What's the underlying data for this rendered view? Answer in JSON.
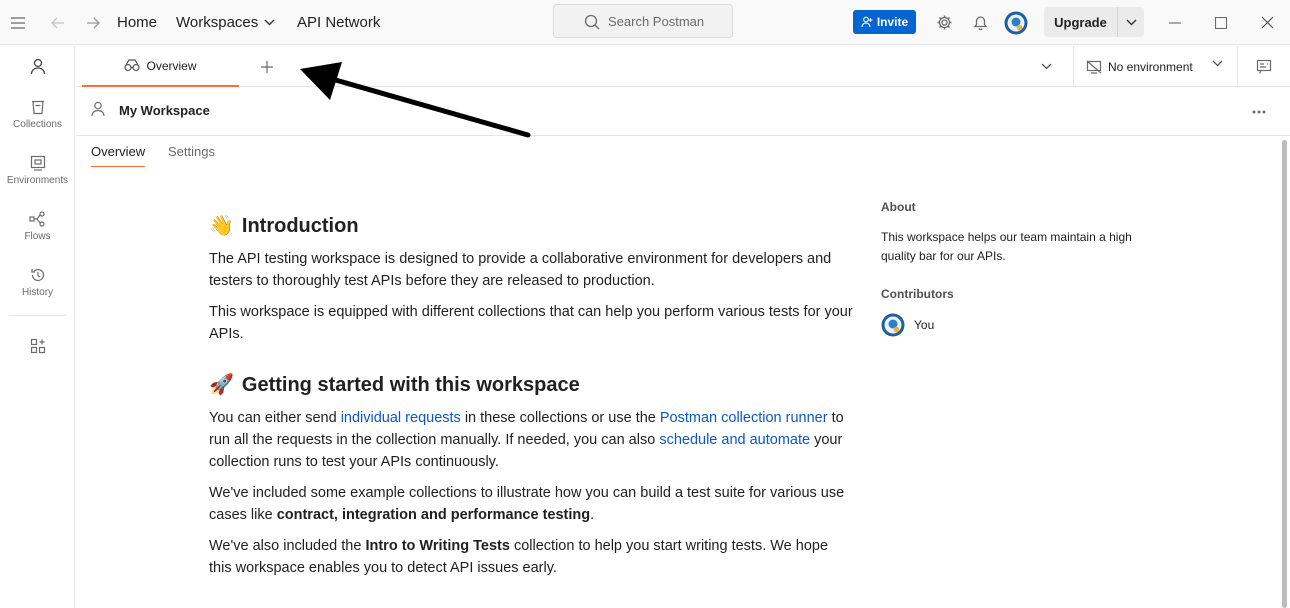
{
  "topbar": {
    "menu_icon": "hamburger-icon",
    "back_icon": "arrow-left-icon",
    "forward_icon": "arrow-right-icon",
    "home": "Home",
    "workspaces": "Workspaces",
    "api_network": "API Network",
    "search_placeholder": "Search Postman",
    "invite": "Invite",
    "upgrade": "Upgrade",
    "brand_color": "#0265d2",
    "accent_color": "#ff6c37"
  },
  "sidebar": {
    "items": [
      {
        "label": "",
        "icon": "user-icon"
      },
      {
        "label": "Collections",
        "icon": "trash-bin-icon"
      },
      {
        "label": "Environments",
        "icon": "environment-icon"
      },
      {
        "label": "Flows",
        "icon": "flows-icon"
      },
      {
        "label": "History",
        "icon": "history-icon"
      },
      {
        "label": "",
        "icon": "add-apps-icon"
      }
    ]
  },
  "tabs": {
    "overview": "Overview",
    "environment": "No environment"
  },
  "workspace": {
    "title": "My Workspace",
    "subtabs": [
      "Overview",
      "Settings"
    ]
  },
  "content": {
    "intro_emoji": "👋",
    "intro_title": "Introduction",
    "intro_p1": "The API testing workspace is designed to provide a collaborative environment for developers and testers to thoroughly test APIs before they are released to production.",
    "intro_p2": "This workspace is equipped with different collections that can help you perform various tests for your APIs.",
    "start_emoji": "🚀",
    "start_title": "Getting started with this workspace",
    "start_p1_a": "You can either send ",
    "start_p1_link1": "individual requests",
    "start_p1_b": " in these collections or use the ",
    "start_p1_link2": "Postman collection runner",
    "start_p1_c": " to run all the requests in the collection manually. If needed, you can also ",
    "start_p1_link3": "schedule and automate",
    "start_p1_d": " your collection runs to test your APIs continuously.",
    "start_p2_a": "We've included some example collections to illustrate how you can build a test suite for various use cases like ",
    "start_p2_bold": "contract, integration and performance testing",
    "start_p2_b": ".",
    "start_p3_a": "We've also included the ",
    "start_p3_bold": "Intro to Writing Tests",
    "start_p3_b": " collection to help you start writing tests. We hope this workspace enables you to detect API issues early."
  },
  "aside": {
    "about_title": "About",
    "about_text": "This workspace helps our team maintain a high quality bar for our APIs.",
    "contributors_title": "Contributors",
    "contributor_name": "You"
  }
}
